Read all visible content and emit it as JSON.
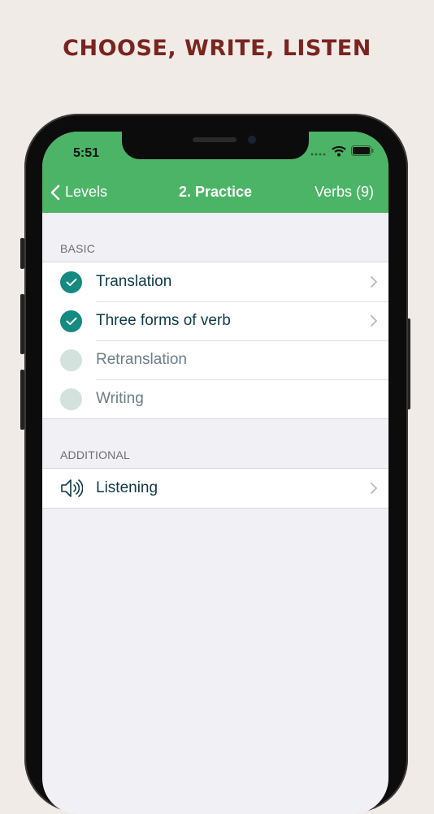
{
  "headline": "CHOOSE, WRITE, LISTEN",
  "status_bar": {
    "time": "5:51",
    "icons": [
      "signal-dots-icon",
      "wifi-icon",
      "battery-icon"
    ]
  },
  "nav": {
    "back_label": "Levels",
    "title": "2. Practice",
    "right_label": "Verbs (9)"
  },
  "sections": [
    {
      "header": "BASIC",
      "items": [
        {
          "label": "Translation",
          "checked": true,
          "has_chevron": true
        },
        {
          "label": "Three forms of verb",
          "checked": true,
          "has_chevron": true
        },
        {
          "label": "Retranslation",
          "checked": false,
          "has_chevron": false
        },
        {
          "label": "Writing",
          "checked": false,
          "has_chevron": false
        }
      ]
    },
    {
      "header": "ADDITIONAL",
      "items": [
        {
          "label": "Listening",
          "icon": "speaker-icon",
          "has_chevron": true
        }
      ]
    }
  ],
  "colors": {
    "nav_bar": "#4cb466",
    "check_on": "#148a80",
    "check_off": "#d3e2dd",
    "headline": "#7a2420",
    "background": "#f0ebe6"
  }
}
